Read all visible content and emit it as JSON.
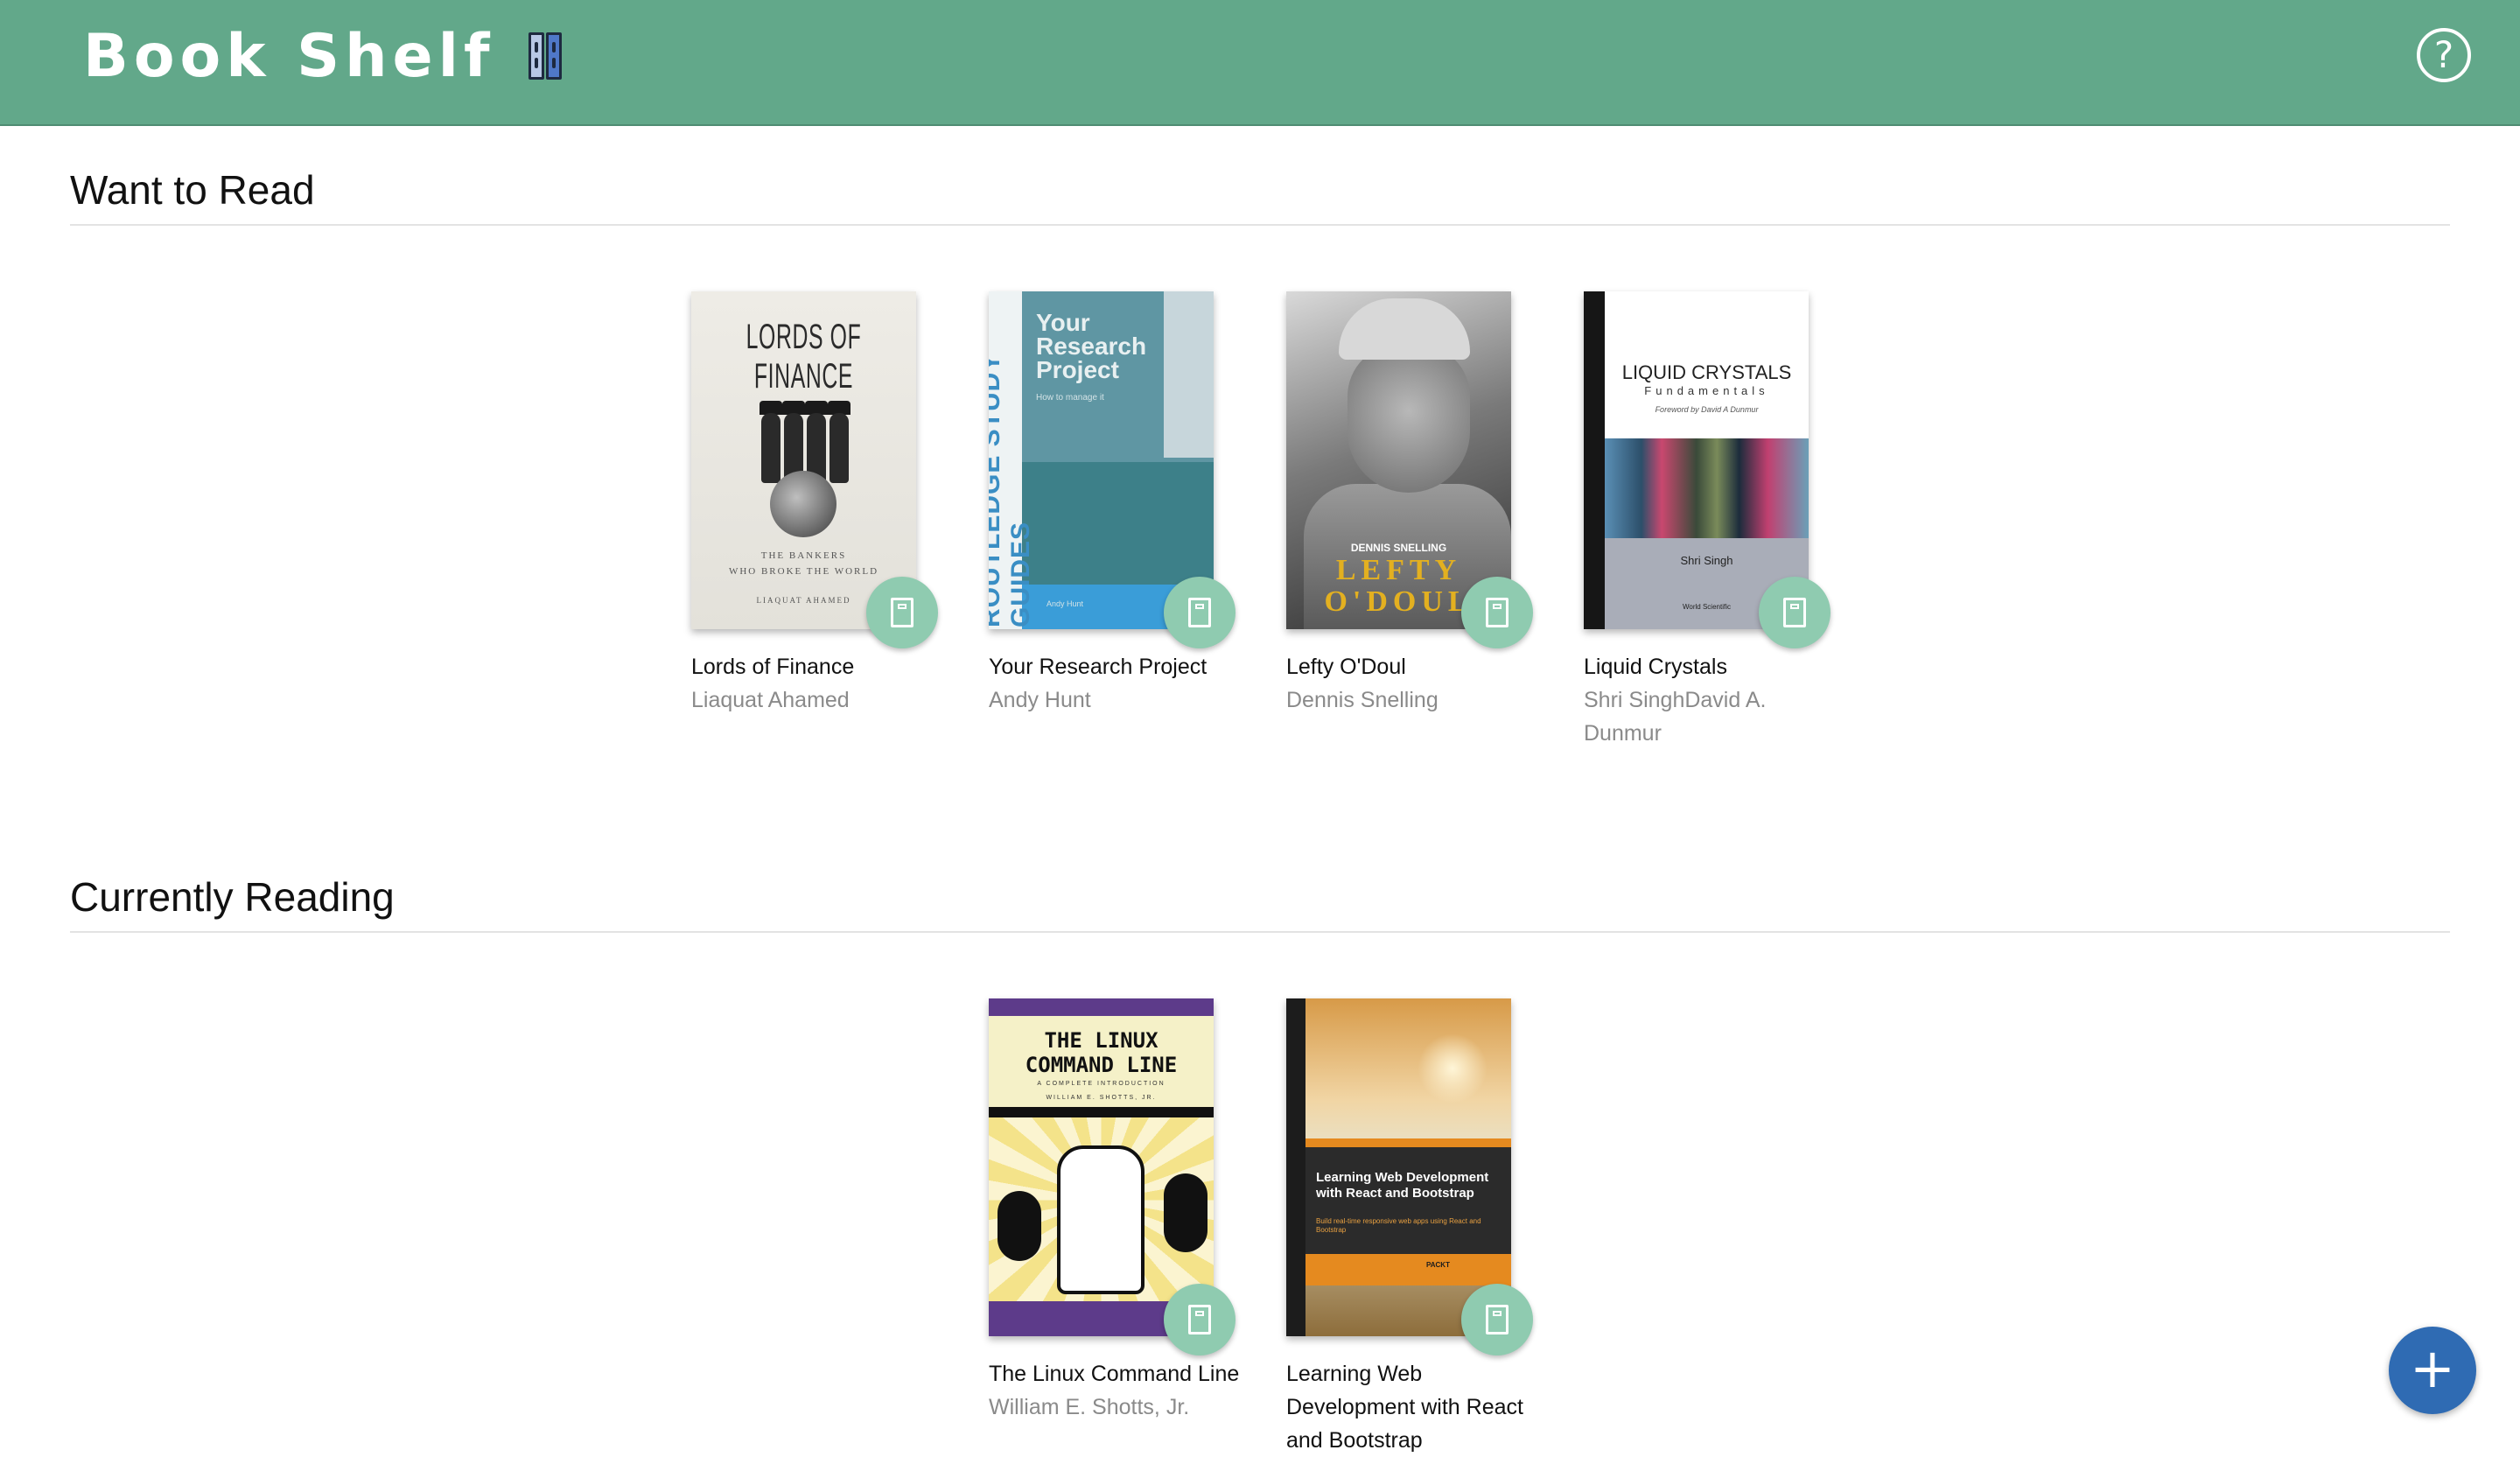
{
  "header": {
    "title": "Book Shelf",
    "help_label": "?"
  },
  "colors": {
    "header_bg": "#62a88a",
    "shelf_changer_bg": "#8fcbb0",
    "add_button_bg": "#2f6bb3",
    "author_text": "#8a8a8a"
  },
  "shelves": [
    {
      "title": "Want to Read",
      "books": [
        {
          "title": "Lords of Finance",
          "authors": [
            "Liaquat Ahamed"
          ],
          "authors_display": "Liaquat Ahamed",
          "cover": {
            "title": "LORDS OF FINANCE",
            "subtitle_line1": "THE BANKERS",
            "subtitle_line2": "WHO BROKE THE WORLD",
            "author": "LIAQUAT AHAMED"
          }
        },
        {
          "title": "Your Research Project",
          "authors": [
            "Andy Hunt"
          ],
          "authors_display": "Andy Hunt",
          "cover": {
            "series": "ROUTLEDGE STUDY GUIDES",
            "title_line1": "Your",
            "title_line2": "Research",
            "title_line3": "Project",
            "subtitle": "How to manage it",
            "author": "Andy Hunt"
          }
        },
        {
          "title": "Lefty O'Doul",
          "authors": [
            "Dennis Snelling"
          ],
          "authors_display": "Dennis Snelling",
          "cover": {
            "author": "DENNIS SNELLING",
            "title_line1": "LEFTY",
            "title_line2": "O'DOUL"
          }
        },
        {
          "title": "Liquid Crystals",
          "authors": [
            "Shri Singh",
            "David A. Dunmur"
          ],
          "authors_display": "Shri SinghDavid A. Dunmur",
          "cover": {
            "title": "LIQUID CRYSTALS",
            "subtitle": "Fundamentals",
            "foreword": "Foreword by David A Dunmur",
            "author": "Shri Singh",
            "publisher": "World Scientific"
          }
        }
      ]
    },
    {
      "title": "Currently Reading",
      "books": [
        {
          "title": "The Linux Command Line",
          "authors": [
            "William E. Shotts, Jr."
          ],
          "authors_display": "William E. Shotts, Jr.",
          "cover": {
            "title_line1": "THE LINUX",
            "title_line2": "COMMAND LINE",
            "subtitle": "A COMPLETE INTRODUCTION",
            "author": "WILLIAM E. SHOTTS, JR."
          }
        },
        {
          "title": "Learning Web Development with React and Bootstrap",
          "authors": [],
          "authors_display": "",
          "cover": {
            "title_line1": "Learning Web Development",
            "title_line2": "with React and Bootstrap",
            "subtitle": "Build real-time responsive web apps using React and Bootstrap",
            "publisher": "PACKT"
          }
        }
      ]
    }
  ],
  "fab": {
    "label": "+"
  },
  "icons": {
    "brand": "binders-icon",
    "help": "question-circle-icon",
    "shelf_changer": "book-move-icon",
    "add": "plus-icon"
  }
}
